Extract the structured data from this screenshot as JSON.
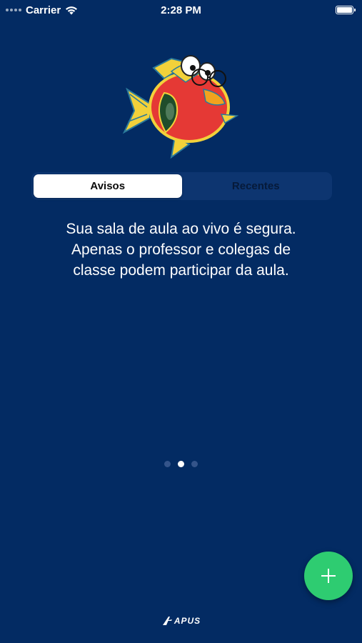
{
  "status_bar": {
    "carrier": "Carrier",
    "time": "2:28 PM",
    "wifi_icon": "wifi-icon",
    "battery_icon": "battery-icon",
    "battery_level": 1.0
  },
  "mascot": {
    "icon": "fish-mascot-icon"
  },
  "tabs": [
    {
      "label": "Avisos",
      "selected": true
    },
    {
      "label": "Recentes",
      "selected": false
    }
  ],
  "message": {
    "lines": [
      "Sua sala de aula ao vivo é segura.",
      "Apenas o professor e colegas de",
      "classe podem participar da aula."
    ]
  },
  "pager": {
    "count": 3,
    "current": 2
  },
  "fab": {
    "icon": "plus-icon",
    "color": "#2ecc71"
  },
  "brand": {
    "text": "APUS"
  },
  "colors": {
    "background": "#032b63",
    "accent": "#2ecc71"
  }
}
